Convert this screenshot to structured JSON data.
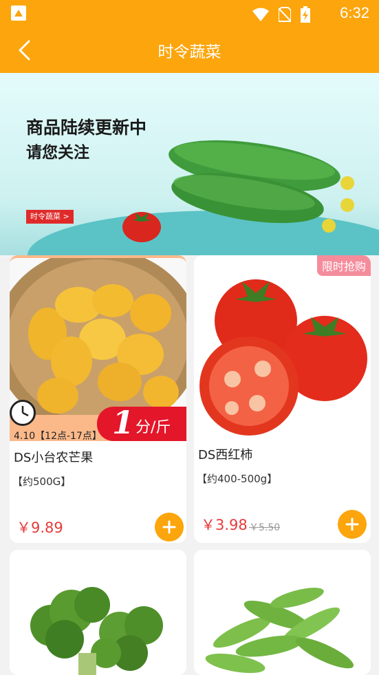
{
  "status_bar": {
    "time": "6:32"
  },
  "header": {
    "title": "时令蔬菜"
  },
  "banner": {
    "line1": "商品陆续更新中",
    "line2": "请您关注",
    "tag": "时令蔬菜 >"
  },
  "products": [
    {
      "name": "DS小台农芒果",
      "spec": "【约500G】",
      "price": "￥9.89",
      "timer_text": "4.10【12点-17点】",
      "promo_num": "1",
      "promo_unit": "分/斤"
    },
    {
      "name": "DS西红柿",
      "spec": "【约400-500g】",
      "price": "￥3.98",
      "old_price": "￥5.50",
      "badge": "限时抢购"
    },
    {
      "name": "",
      "spec": ""
    },
    {
      "name": "",
      "spec": ""
    }
  ],
  "colors": {
    "accent": "#fca50c",
    "price": "#e83a3a",
    "badge": "#f58c9c"
  }
}
